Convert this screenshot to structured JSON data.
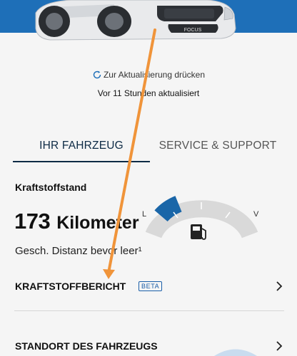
{
  "hero": {
    "car_badge": "FOCUS"
  },
  "refresh": {
    "label": "Zur Aktualisierung drücken",
    "icon": "refresh-icon"
  },
  "status": {
    "last_updated": "Vor 11 Stunden aktualisiert"
  },
  "tabs": [
    {
      "label": "IHR FAHRZEUG",
      "active": true
    },
    {
      "label": "SERVICE & SUPPORT",
      "active": false
    }
  ],
  "fuel": {
    "section_title": "Kraftstoffstand",
    "range_value": "173",
    "range_unit": "Kilometer",
    "range_caption": "Gesch. Distanz bevor leer¹",
    "gauge_empty_label": "L",
    "gauge_full_label": "V",
    "gauge_level": 0.25
  },
  "menu": {
    "fuel_report_label": "KRAFTSTOFFBERICHT",
    "fuel_report_badge": "BETA",
    "vehicle_location_label": "STANDORT DES FAHRZEUGS"
  },
  "colors": {
    "brand_blue": "#1e6fb8",
    "gauge_fill": "#1a66a8",
    "gauge_track": "#d9d9d9",
    "annotation_orange": "#f0943a"
  }
}
